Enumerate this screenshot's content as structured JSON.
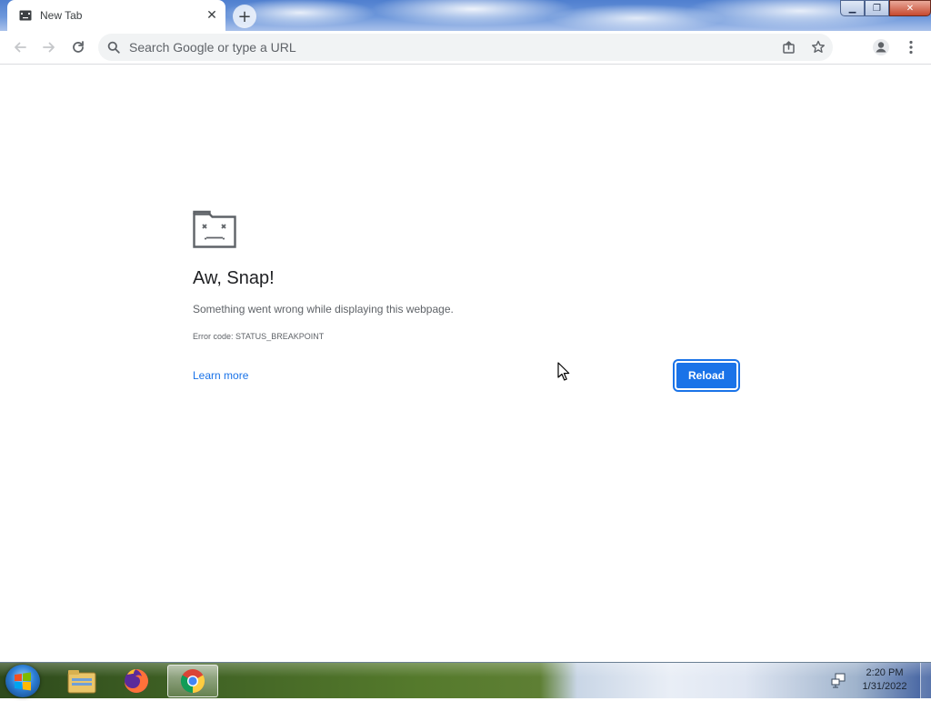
{
  "browser": {
    "tab": {
      "title": "New Tab",
      "close_symbol": "✕"
    },
    "new_tab_symbol": "+",
    "window_controls": {
      "minimize_symbol": "▁",
      "restore_symbol": "❐",
      "close_symbol": "✕"
    },
    "toolbar": {
      "omnibox_placeholder": "Search Google or type a URL",
      "icons": [
        "back-arrow-icon",
        "forward-arrow-icon",
        "reload-icon",
        "search-icon",
        "share-icon",
        "star-icon",
        "profile-icon",
        "menu-kebab-icon"
      ]
    }
  },
  "error_page": {
    "icon": "sad-tab-icon",
    "title": "Aw, Snap!",
    "description": "Something went wrong while displaying this webpage.",
    "error_code": "Error code: STATUS_BREAKPOINT",
    "learn_more": "Learn more",
    "reload_label": "Reload",
    "accent_color": "#1a73e8"
  },
  "taskbar": {
    "apps": [
      "windows-start-icon",
      "file-explorer-icon",
      "firefox-icon",
      "chrome-icon"
    ],
    "active_app": "chrome-icon",
    "clock_time": "2:20 PM",
    "clock_date": "1/31/2022"
  }
}
